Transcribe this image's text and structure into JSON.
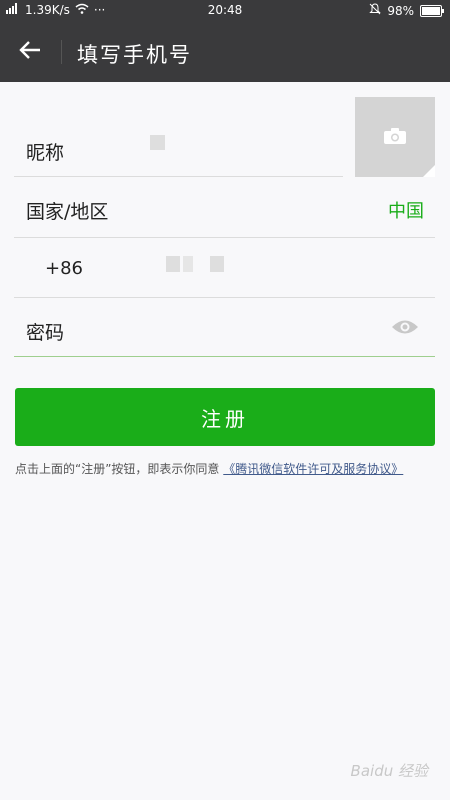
{
  "status_bar": {
    "network": "1.39K/s",
    "time": "20:48",
    "battery": "98%",
    "battery_level": 0.98,
    "dots": "···"
  },
  "nav": {
    "title": "填写手机号"
  },
  "form": {
    "nickname_label": "昵称",
    "region_label": "国家/地区",
    "region_value": "中国",
    "phone_code": "+86",
    "password_label": "密码"
  },
  "register_button_label": "注册",
  "agreement": {
    "text": "点击上面的“注册”按钮，即表示你同意",
    "link": "《腾讯微信软件许可及服务协议》"
  },
  "watermark": "Baidu 经验",
  "colors": {
    "bar_bg": "#3a3a3c",
    "accent_green": "#1aad19",
    "link_blue": "#415a8b"
  }
}
